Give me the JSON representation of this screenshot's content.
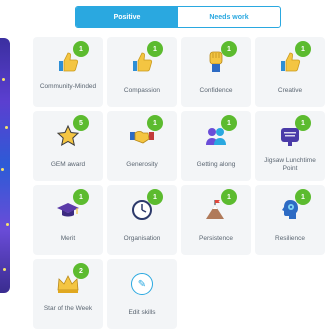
{
  "tabs": [
    {
      "label": "Positive",
      "active": true
    },
    {
      "label": "Needs work",
      "active": false
    }
  ],
  "skills": [
    {
      "name": "Community-Minded",
      "count": "1",
      "icon": "thumbs-up-icon"
    },
    {
      "name": "Compassion",
      "count": "1",
      "icon": "thumbs-up-icon"
    },
    {
      "name": "Confidence",
      "count": "1",
      "icon": "raised-fist-icon"
    },
    {
      "name": "Creative",
      "count": "1",
      "icon": "thumbs-up-icon"
    },
    {
      "name": "GEM award",
      "count": "5",
      "icon": "star-icon"
    },
    {
      "name": "Generosity",
      "count": "1",
      "icon": "handshake-icon"
    },
    {
      "name": "Getting along",
      "count": "1",
      "icon": "people-icon"
    },
    {
      "name": "Jigsaw Lunchtime Point",
      "count": "1",
      "icon": "jigsaw-sign-icon"
    },
    {
      "name": "Merit",
      "count": "1",
      "icon": "graduation-cap-icon"
    },
    {
      "name": "Organisation",
      "count": "1",
      "icon": "clock-icon"
    },
    {
      "name": "Persistence",
      "count": "1",
      "icon": "mountain-flag-icon"
    },
    {
      "name": "Resilience",
      "count": "1",
      "icon": "head-gear-icon"
    },
    {
      "name": "Star of the Week",
      "count": "2",
      "icon": "crown-icon"
    }
  ],
  "edit": {
    "label": "Edit skills",
    "icon": "pencil-icon"
  },
  "colors": {
    "accent": "#2aa8e0",
    "badge": "#5cbb2f",
    "tile": "#f3f5f7"
  }
}
